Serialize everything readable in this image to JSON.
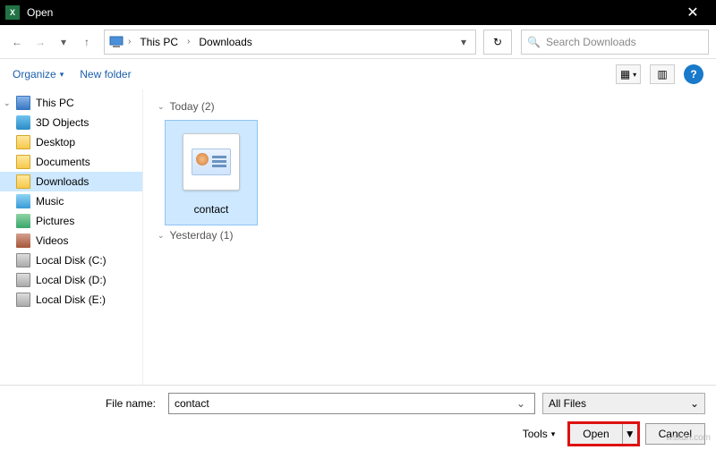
{
  "titlebar": {
    "app_icon_text": "X",
    "title": "Open",
    "close_glyph": "✕"
  },
  "nav": {
    "back_glyph": "←",
    "forward_glyph": "→",
    "recent_glyph": "▾",
    "up_glyph": "↑",
    "crumbs": [
      "This PC",
      "Downloads"
    ],
    "crumb_sep": "›",
    "addr_dropdown_glyph": "▾",
    "refresh_glyph": "↻"
  },
  "search": {
    "icon_glyph": "🔍",
    "placeholder": "Search Downloads"
  },
  "toolbar": {
    "organize_label": "Organize",
    "organize_arrow": "▾",
    "new_folder_label": "New folder",
    "view_glyph_1": "▦",
    "view_arrow": "▾",
    "view_glyph_2": "▥",
    "help_glyph": "?"
  },
  "sidebar": {
    "items": [
      {
        "label": "This PC",
        "icon": "pc",
        "expanded": true
      },
      {
        "label": "3D Objects",
        "icon": "obj3d"
      },
      {
        "label": "Desktop",
        "icon": "folder"
      },
      {
        "label": "Documents",
        "icon": "folder"
      },
      {
        "label": "Downloads",
        "icon": "folder",
        "selected": true
      },
      {
        "label": "Music",
        "icon": "music"
      },
      {
        "label": "Pictures",
        "icon": "pic"
      },
      {
        "label": "Videos",
        "icon": "vid"
      },
      {
        "label": "Local Disk (C:)",
        "icon": "disk"
      },
      {
        "label": "Local Disk (D:)",
        "icon": "disk"
      },
      {
        "label": "Local Disk (E:)",
        "icon": "disk"
      }
    ]
  },
  "content": {
    "groups": [
      {
        "label": "Today (2)",
        "files": [
          {
            "name": "contact",
            "selected": true,
            "highlight": true
          }
        ]
      },
      {
        "label": "Yesterday (1)",
        "files": []
      }
    ]
  },
  "footer": {
    "file_name_label": "File name:",
    "file_name_value": "contact",
    "filter_label": "All Files",
    "filter_arrow": "⌄",
    "tools_label": "Tools",
    "tools_arrow": "▾",
    "open_label": "Open",
    "open_arrow": "▼",
    "cancel_label": "Cancel"
  },
  "watermark": "wsxdn.com"
}
